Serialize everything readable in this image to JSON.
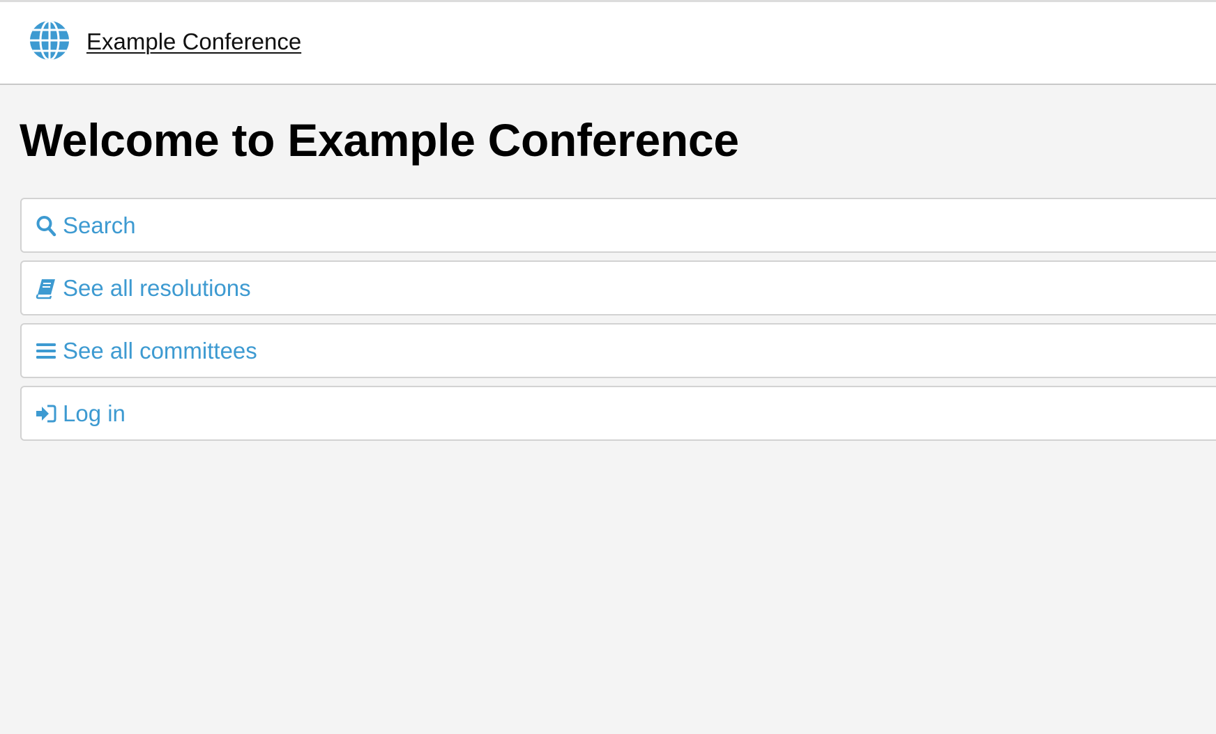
{
  "header": {
    "site_title": "Example Conference",
    "logo_icon": "globe-icon"
  },
  "main": {
    "title": "Welcome to Example Conference",
    "nav_items": [
      {
        "label": "Search",
        "icon": "search-icon"
      },
      {
        "label": "See all resolutions",
        "icon": "book-icon"
      },
      {
        "label": "See all committees",
        "icon": "list-icon"
      },
      {
        "label": "Log in",
        "icon": "sign-in-icon"
      }
    ]
  },
  "colors": {
    "accent": "#3d9ad1",
    "page_background": "#f4f4f4",
    "header_background": "#ffffff",
    "border": "#d2d2d2"
  }
}
